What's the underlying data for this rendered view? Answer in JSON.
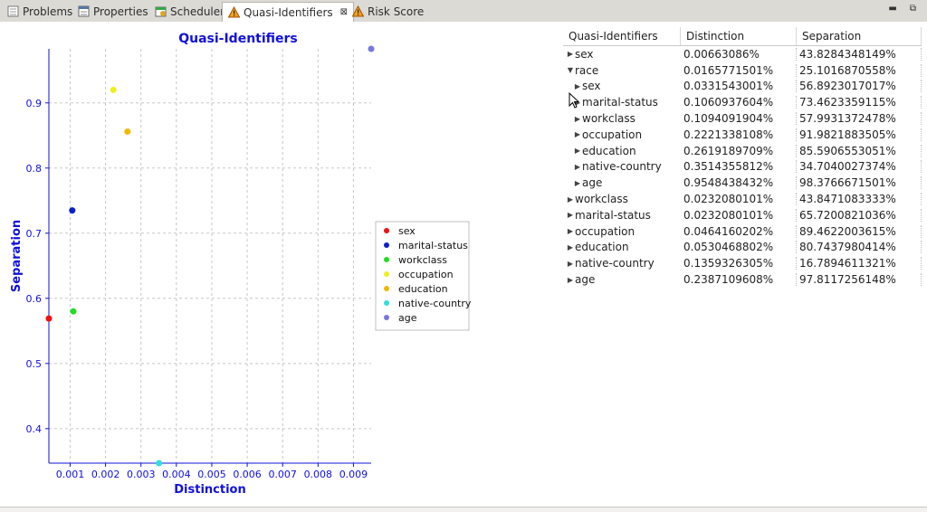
{
  "tabs": [
    {
      "label": "Problems",
      "icon": "problems-icon",
      "left": 2,
      "active": false
    },
    {
      "label": "Properties",
      "icon": "properties-icon",
      "left": 80,
      "active": false
    },
    {
      "label": "Scheduler",
      "icon": "scheduler-icon",
      "left": 165,
      "active": false
    },
    {
      "label": "Quasi-Identifiers",
      "icon": "warning-icon",
      "left": 245,
      "active": true,
      "close": "⊠"
    },
    {
      "label": "Risk Score",
      "icon": "warning-icon",
      "left": 383,
      "active": false
    }
  ],
  "window_controls": {
    "minimize": "▬",
    "restore": "⧉"
  },
  "chart_data": {
    "type": "scatter",
    "title": "Quasi-Identifiers",
    "xlabel": "Distinction",
    "ylabel": "Separation",
    "xlim": [
      0.0004,
      0.0095
    ],
    "ylim": [
      0.347,
      0.983
    ],
    "xticks": [
      "0.001",
      "0.002",
      "0.003",
      "0.004",
      "0.005",
      "0.006",
      "0.007",
      "0.008",
      "0.009"
    ],
    "xtick_values": [
      0.001,
      0.002,
      0.003,
      0.004,
      0.005,
      0.006,
      0.007,
      0.008,
      0.009
    ],
    "yticks": [
      "0.4",
      "0.5",
      "0.6",
      "0.7",
      "0.8",
      "0.9"
    ],
    "ytick_values": [
      0.4,
      0.5,
      0.6,
      0.7,
      0.8,
      0.9
    ],
    "grid": true,
    "legend_position": "right",
    "series": [
      {
        "name": "sex",
        "color": "#ee1111",
        "x": 0.000398,
        "y": 0.569
      },
      {
        "name": "marital-status",
        "color": "#0a1fcc",
        "x": 0.00106,
        "y": 0.735
      },
      {
        "name": "workclass",
        "color": "#22dd22",
        "x": 0.00109,
        "y": 0.58
      },
      {
        "name": "occupation",
        "color": "#eeee22",
        "x": 0.00222,
        "y": 0.92
      },
      {
        "name": "education",
        "color": "#f0b800",
        "x": 0.00262,
        "y": 0.856
      },
      {
        "name": "native-country",
        "color": "#33dddd",
        "x": 0.00351,
        "y": 0.347
      },
      {
        "name": "age",
        "color": "#7777dd",
        "x": 0.00955,
        "y": 0.983
      }
    ]
  },
  "table": {
    "headers": [
      "Quasi-Identifiers",
      "Distinction",
      "Separation"
    ],
    "rows": [
      {
        "name": "sex",
        "level": 0,
        "expanded": false,
        "distinction": "0.00663086%",
        "separation": "43.8284348149%"
      },
      {
        "name": "race",
        "level": 0,
        "expanded": true,
        "distinction": "0.0165771501%",
        "separation": "25.1016870558%"
      },
      {
        "name": "sex",
        "level": 1,
        "expanded": false,
        "distinction": "0.0331543001%",
        "separation": "56.8923017017%"
      },
      {
        "name": "marital-status",
        "level": 1,
        "expanded": false,
        "distinction": "0.1060937604%",
        "separation": "73.4623359115%"
      },
      {
        "name": "workclass",
        "level": 1,
        "expanded": false,
        "distinction": "0.1094091904%",
        "separation": "57.9931372478%"
      },
      {
        "name": "occupation",
        "level": 1,
        "expanded": false,
        "distinction": "0.2221338108%",
        "separation": "91.9821883505%"
      },
      {
        "name": "education",
        "level": 1,
        "expanded": false,
        "distinction": "0.2619189709%",
        "separation": "85.5906553051%"
      },
      {
        "name": "native-country",
        "level": 1,
        "expanded": false,
        "distinction": "0.3514355812%",
        "separation": "34.7040027374%"
      },
      {
        "name": "age",
        "level": 1,
        "expanded": false,
        "distinction": "0.9548438432%",
        "separation": "98.3766671501%"
      },
      {
        "name": "workclass",
        "level": 0,
        "expanded": false,
        "distinction": "0.0232080101%",
        "separation": "43.8471083333%"
      },
      {
        "name": "marital-status",
        "level": 0,
        "expanded": false,
        "distinction": "0.0232080101%",
        "separation": "65.7200821036%"
      },
      {
        "name": "occupation",
        "level": 0,
        "expanded": false,
        "distinction": "0.0464160202%",
        "separation": "89.4622003615%"
      },
      {
        "name": "education",
        "level": 0,
        "expanded": false,
        "distinction": "0.0530468802%",
        "separation": "80.7437980414%"
      },
      {
        "name": "native-country",
        "level": 0,
        "expanded": false,
        "distinction": "0.1359326305%",
        "separation": "16.7894611321%"
      },
      {
        "name": "age",
        "level": 0,
        "expanded": false,
        "distinction": "0.2387109608%",
        "separation": "97.8117256148%"
      }
    ]
  },
  "colors": {
    "chart_blue": "#1010dd",
    "grid": "#c8c8c8"
  }
}
